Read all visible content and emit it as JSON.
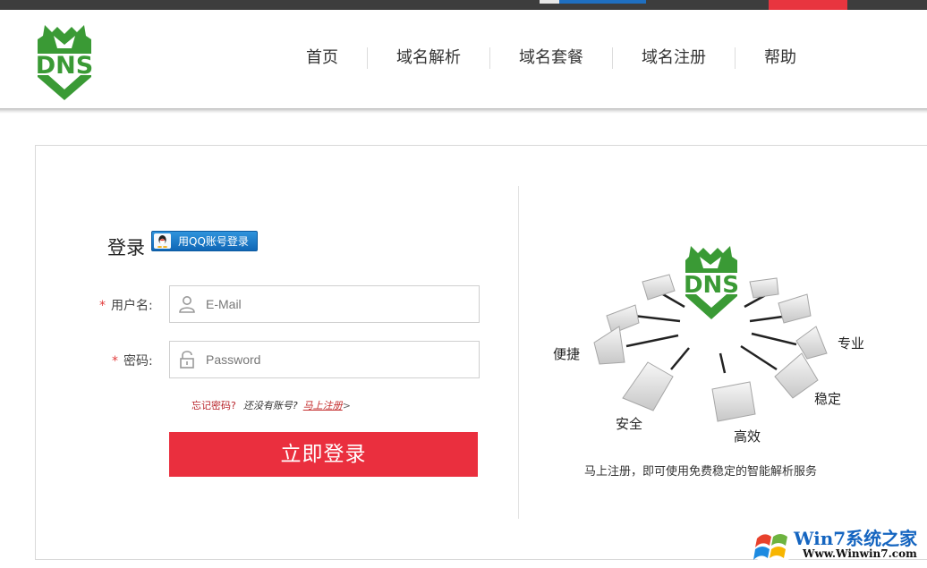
{
  "nav": {
    "items": [
      {
        "label": "首页"
      },
      {
        "label": "域名解析"
      },
      {
        "label": "域名套餐"
      },
      {
        "label": "域名注册"
      },
      {
        "label": "帮助"
      }
    ]
  },
  "logo": {
    "text": "DNS",
    "color": "#3a9a35"
  },
  "login": {
    "title": "登录",
    "qq_button": "用QQ账号登录",
    "username_label": "用户名:",
    "username_placeholder": "E-Mail",
    "password_label": "密码:",
    "password_placeholder": "Password",
    "required_mark": "*",
    "forgot_link": "忘记密码?",
    "no_account": "还没有账号?",
    "register_link": "马上注册",
    "register_arrow": ">",
    "submit": "立即登录",
    "accent": "#ea2f3e"
  },
  "promo": {
    "logo_text": "DNS",
    "features": [
      "便捷",
      "专业",
      "安全",
      "高效",
      "稳定"
    ],
    "caption": "马上注册，即可使用免费稳定的智能解析服务"
  },
  "watermark": {
    "title": "Win7系统之家",
    "url": "Www.Winwin7.com"
  }
}
